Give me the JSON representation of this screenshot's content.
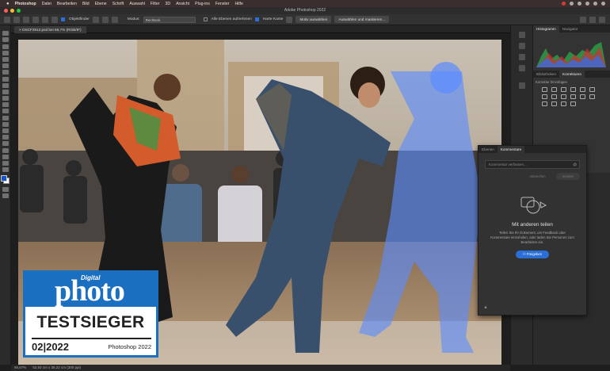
{
  "menubar": {
    "app": "Photoshop",
    "items": [
      "Datei",
      "Bearbeiten",
      "Bild",
      "Ebene",
      "Schrift",
      "Auswahl",
      "Filter",
      "3D",
      "Ansicht",
      "Plug-ins",
      "Fenster",
      "Hilfe"
    ]
  },
  "window": {
    "title": "Adobe Photoshop 2022"
  },
  "options": {
    "objektfinder": "Objektfinder",
    "modus_label": "Modus:",
    "modus_value": "Rechteck",
    "alle_ebenen": "Alle Ebenen aufnehmen",
    "harte_kante": "Harte Kante",
    "motiv": "Motiv auswählen",
    "maskieren": "Auswählen und maskieren..."
  },
  "document": {
    "tab": "DSCF2912.psd bei 66,7% (RGB/8*)"
  },
  "status": {
    "zoom": "66,67%",
    "size": "52,93 cm x 35,22 cm (300 ppi)"
  },
  "panels": {
    "tab_histogram": "Histogramm",
    "tab_navigator": "Navigator",
    "tab_bibliotheken": "Bibliotheken",
    "tab_korrekturen": "Korrekturen",
    "korr_label": "Korrektur hinzufügen"
  },
  "comments": {
    "tab_ebenen": "Ebenen",
    "tab_kommentare": "Kommentare",
    "placeholder": "Kommentar verfassen...",
    "cancel": "Abbrechen",
    "send": "Senden",
    "title": "Mit anderen teilen",
    "text": "Teilen Sie Ihr Dokument, um Feedback oder Kommentare einzuholen, oder laden Sie Personen zum Bearbeiten ein.",
    "share": "Freigeben"
  },
  "badge": {
    "digital": "Digital",
    "photo": "photo",
    "title": "TESTSIEGER",
    "date": "02|2022",
    "product": "Photoshop 2022"
  },
  "colors": {
    "accent": "#2b6fd6",
    "badge_blue": "#1a6fc1",
    "selection_overlay": "#5a8cff"
  }
}
